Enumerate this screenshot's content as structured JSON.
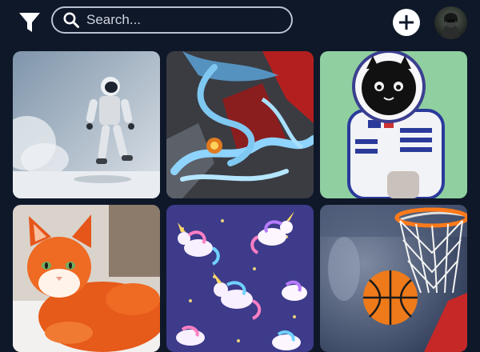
{
  "toolbar": {
    "filter_icon": "filter-icon",
    "search": {
      "placeholder": "Search...",
      "value": "",
      "icon": "search-icon"
    },
    "add_icon": "plus-circle-icon",
    "avatar_icon": "user-avatar"
  },
  "gallery": {
    "items": [
      {
        "subject": "astronaut-walking"
      },
      {
        "subject": "blue-red-swirl"
      },
      {
        "subject": "pixel-cat-astronaut"
      },
      {
        "subject": "orange-cat"
      },
      {
        "subject": "unicorn-pattern"
      },
      {
        "subject": "basketball-hoop"
      }
    ]
  },
  "colors": {
    "background": "#0f1829",
    "accent": "#ffffff"
  }
}
